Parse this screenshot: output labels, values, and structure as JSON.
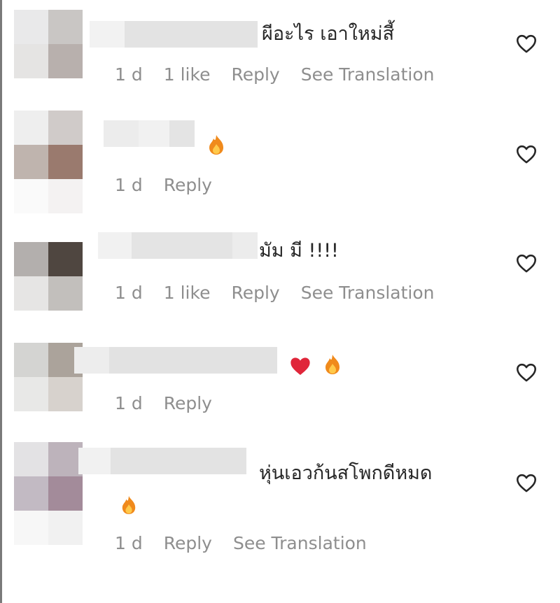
{
  "comments": [
    {
      "text": "ผีอะไร เอาใหม่สี้",
      "emojis": [],
      "meta": {
        "time": "1 d",
        "likes": "1 like",
        "reply": "Reply",
        "translate": "See Translation"
      }
    },
    {
      "text": "",
      "emojis": [
        "fire-emoji"
      ],
      "meta": {
        "time": "1 d",
        "reply": "Reply"
      }
    },
    {
      "text": "มัม มี !!!!",
      "emojis": [],
      "meta": {
        "time": "1 d",
        "likes": "1 like",
        "reply": "Reply",
        "translate": "See Translation"
      }
    },
    {
      "text": "",
      "emojis": [
        "red-heart-emoji",
        "fire-emoji"
      ],
      "meta": {
        "time": "1 d",
        "reply": "Reply"
      }
    },
    {
      "text": "หุ่นเอวก้นสโพกดีหมด",
      "emojis": [
        "fire-emoji"
      ],
      "meta": {
        "time": "1 d",
        "reply": "Reply",
        "translate": "See Translation"
      }
    }
  ],
  "icons": {
    "like": "heart-outline-icon"
  },
  "colors": {
    "meta_text": "#8e8e8e",
    "body_text": "#262626",
    "fire": "#f08a1c",
    "heart": "#e0263a"
  }
}
